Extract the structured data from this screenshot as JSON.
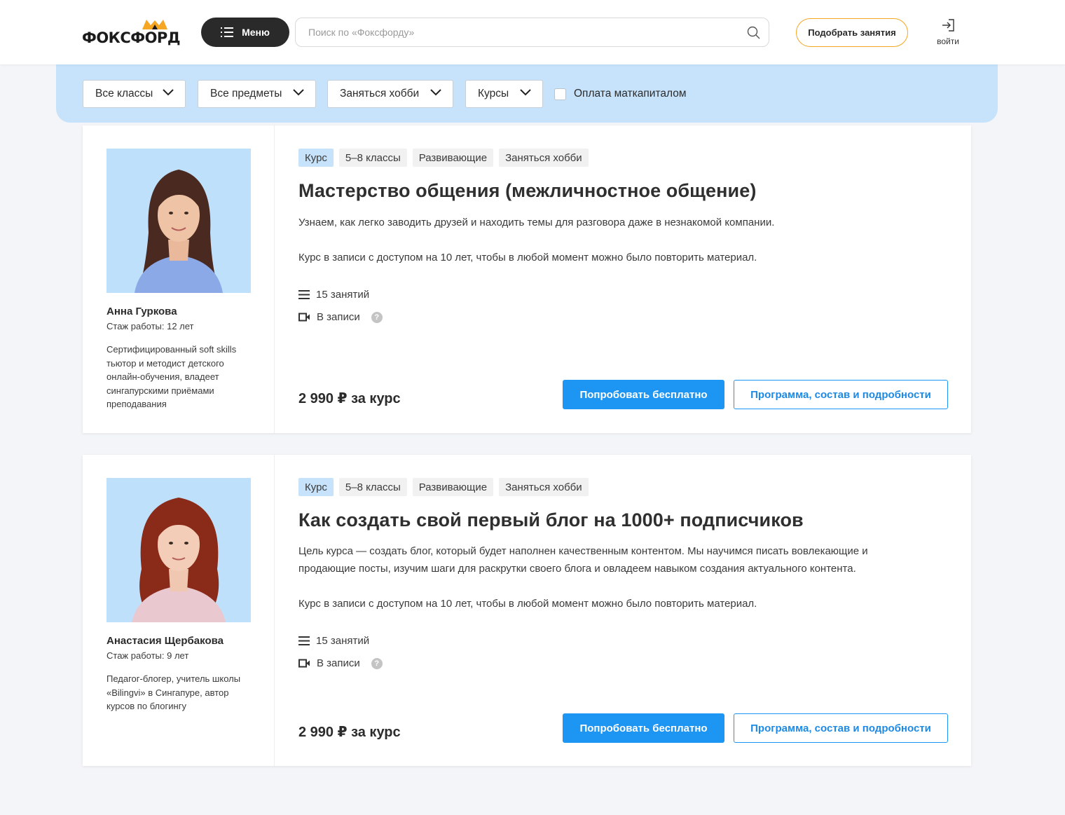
{
  "header": {
    "logo_text": "ФОКСФОРД",
    "menu_label": "Меню",
    "search_placeholder": "Поиск по «Фоксфорду»",
    "pick_label": "Подобрать занятия",
    "login_label": "войти"
  },
  "filters": {
    "classes": "Все классы",
    "subjects": "Все предметы",
    "goal": "Заняться хобби",
    "type": "Курсы",
    "matcapital": "Оплата маткапиталом"
  },
  "cards": [
    {
      "tags": [
        "Курс",
        "5–8 классы",
        "Развивающие",
        "Заняться хобби"
      ],
      "title": "Мастерство общения (межличностное общение)",
      "description": "Узнаем, как легко заводить друзей и находить темы для разговора даже в незнакомой компании.",
      "note": "Курс в записи с доступом на 10 лет, чтобы в любой момент можно было повторить материал.",
      "lessons": "15 занятий",
      "format": "В записи",
      "price": "2 990 ₽ за курс",
      "try_label": "Попробовать бесплатно",
      "program_label": "Программа, состав и подробности",
      "teacher": {
        "name": "Анна Гуркова",
        "experience": "Стаж работы: 12 лет",
        "bio": "Сертифицированный soft skills тьютор и методист детского онлайн-обучения, владеет сингапурскими приёмами преподавания"
      }
    },
    {
      "tags": [
        "Курс",
        "5–8 классы",
        "Развивающие",
        "Заняться хобби"
      ],
      "title": "Как создать свой первый блог на 1000+ подписчиков",
      "description": "Цель курса — создать блог, который будет наполнен качественным контентом. Мы научимся писать вовлекающие и продающие посты, изучим шаги для раскрутки своего блога и овладеем навыком создания актуального контента.",
      "note": "Курс в записи с доступом на 10 лет, чтобы в любой момент можно было повторить материал.",
      "lessons": "15 занятий",
      "format": "В записи",
      "price": "2 990 ₽ за курс",
      "try_label": "Попробовать бесплатно",
      "program_label": "Программа, состав и подробности",
      "teacher": {
        "name": "Анастасия Щербакова",
        "experience": "Стаж работы: 9 лет",
        "bio": "Педагог-блогер, учитель школы «Bilingvi» в Сингапуре, автор курсов по блогингу"
      }
    }
  ],
  "colors": {
    "accent_blue": "#1d95f2",
    "filter_bg": "#c6e3fb",
    "logo_orange": "#f5a623",
    "menu_dark": "#2a2a2a"
  },
  "icons": {
    "menu": "list-icon",
    "search": "search-icon",
    "login": "sign-in-icon",
    "dropdown": "chevron-down-icon",
    "lessons": "list-icon",
    "format": "video-camera-icon",
    "help": "question-icon"
  }
}
